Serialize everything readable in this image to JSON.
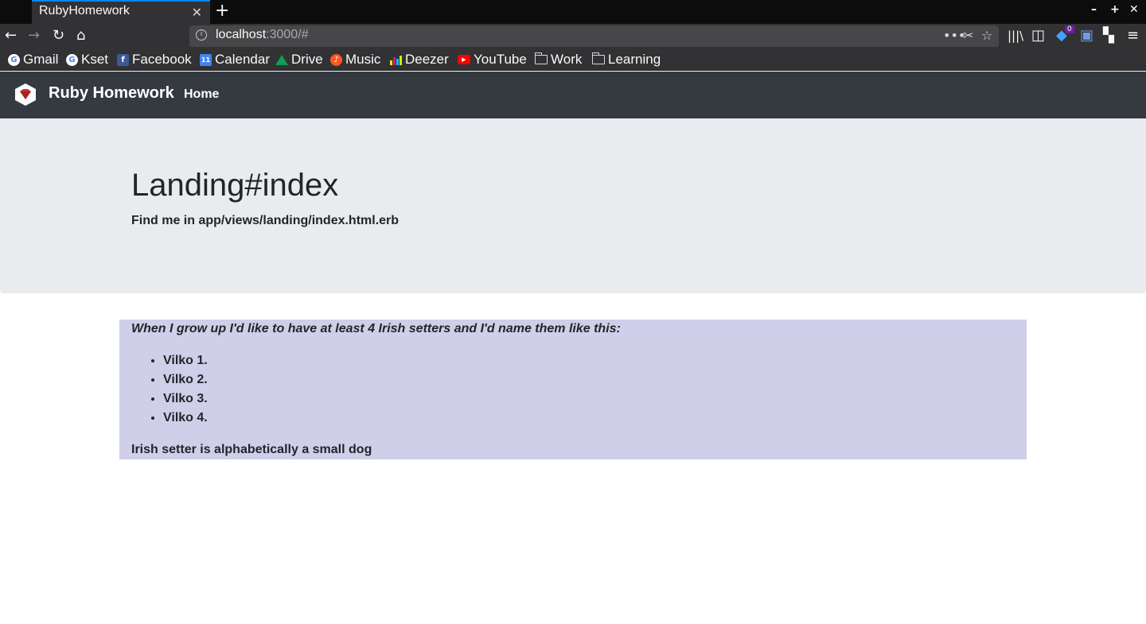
{
  "browser": {
    "tab_title": "RubyHomework",
    "tab_close": "✕",
    "new_tab": "+",
    "url_host": "localhost",
    "url_rest": ":3000/#",
    "bookmarks": [
      {
        "label": "Gmail",
        "icon": "google-icon",
        "color": "#4285f4"
      },
      {
        "label": "Kset",
        "icon": "google-icon",
        "color": "#4285f4"
      },
      {
        "label": "Facebook",
        "icon": "facebook-icon",
        "color": "#3b5998"
      },
      {
        "label": "Calendar",
        "icon": "calendar-icon",
        "color": "#4285f4"
      },
      {
        "label": "Drive",
        "icon": "drive-icon",
        "color": "#0f9d58"
      },
      {
        "label": "Music",
        "icon": "music-icon",
        "color": "#ff5722"
      },
      {
        "label": "Deezer",
        "icon": "deezer-icon",
        "color": "#ef5466"
      },
      {
        "label": "YouTube",
        "icon": "youtube-icon",
        "color": "#ff0000"
      },
      {
        "label": "Work",
        "icon": "folder-icon"
      },
      {
        "label": "Learning",
        "icon": "folder-icon"
      }
    ],
    "extension_badge": "0"
  },
  "app": {
    "brand": "Ruby Homework",
    "nav_home": "Home",
    "logo_color": "#cc342d"
  },
  "jumbotron": {
    "title": "Landing#index",
    "subtitle": "Find me in app/views/landing/index.html.erb"
  },
  "content": {
    "intro": "When I grow up I'd like to have at least 4 Irish setters and I'd name them like this:",
    "dogs": [
      "Vilko 1.",
      "Vilko 2.",
      "Vilko 3.",
      "Vilko 4."
    ],
    "outro": "Irish setter is alphabetically a small dog",
    "background": "#d0cfe9"
  }
}
